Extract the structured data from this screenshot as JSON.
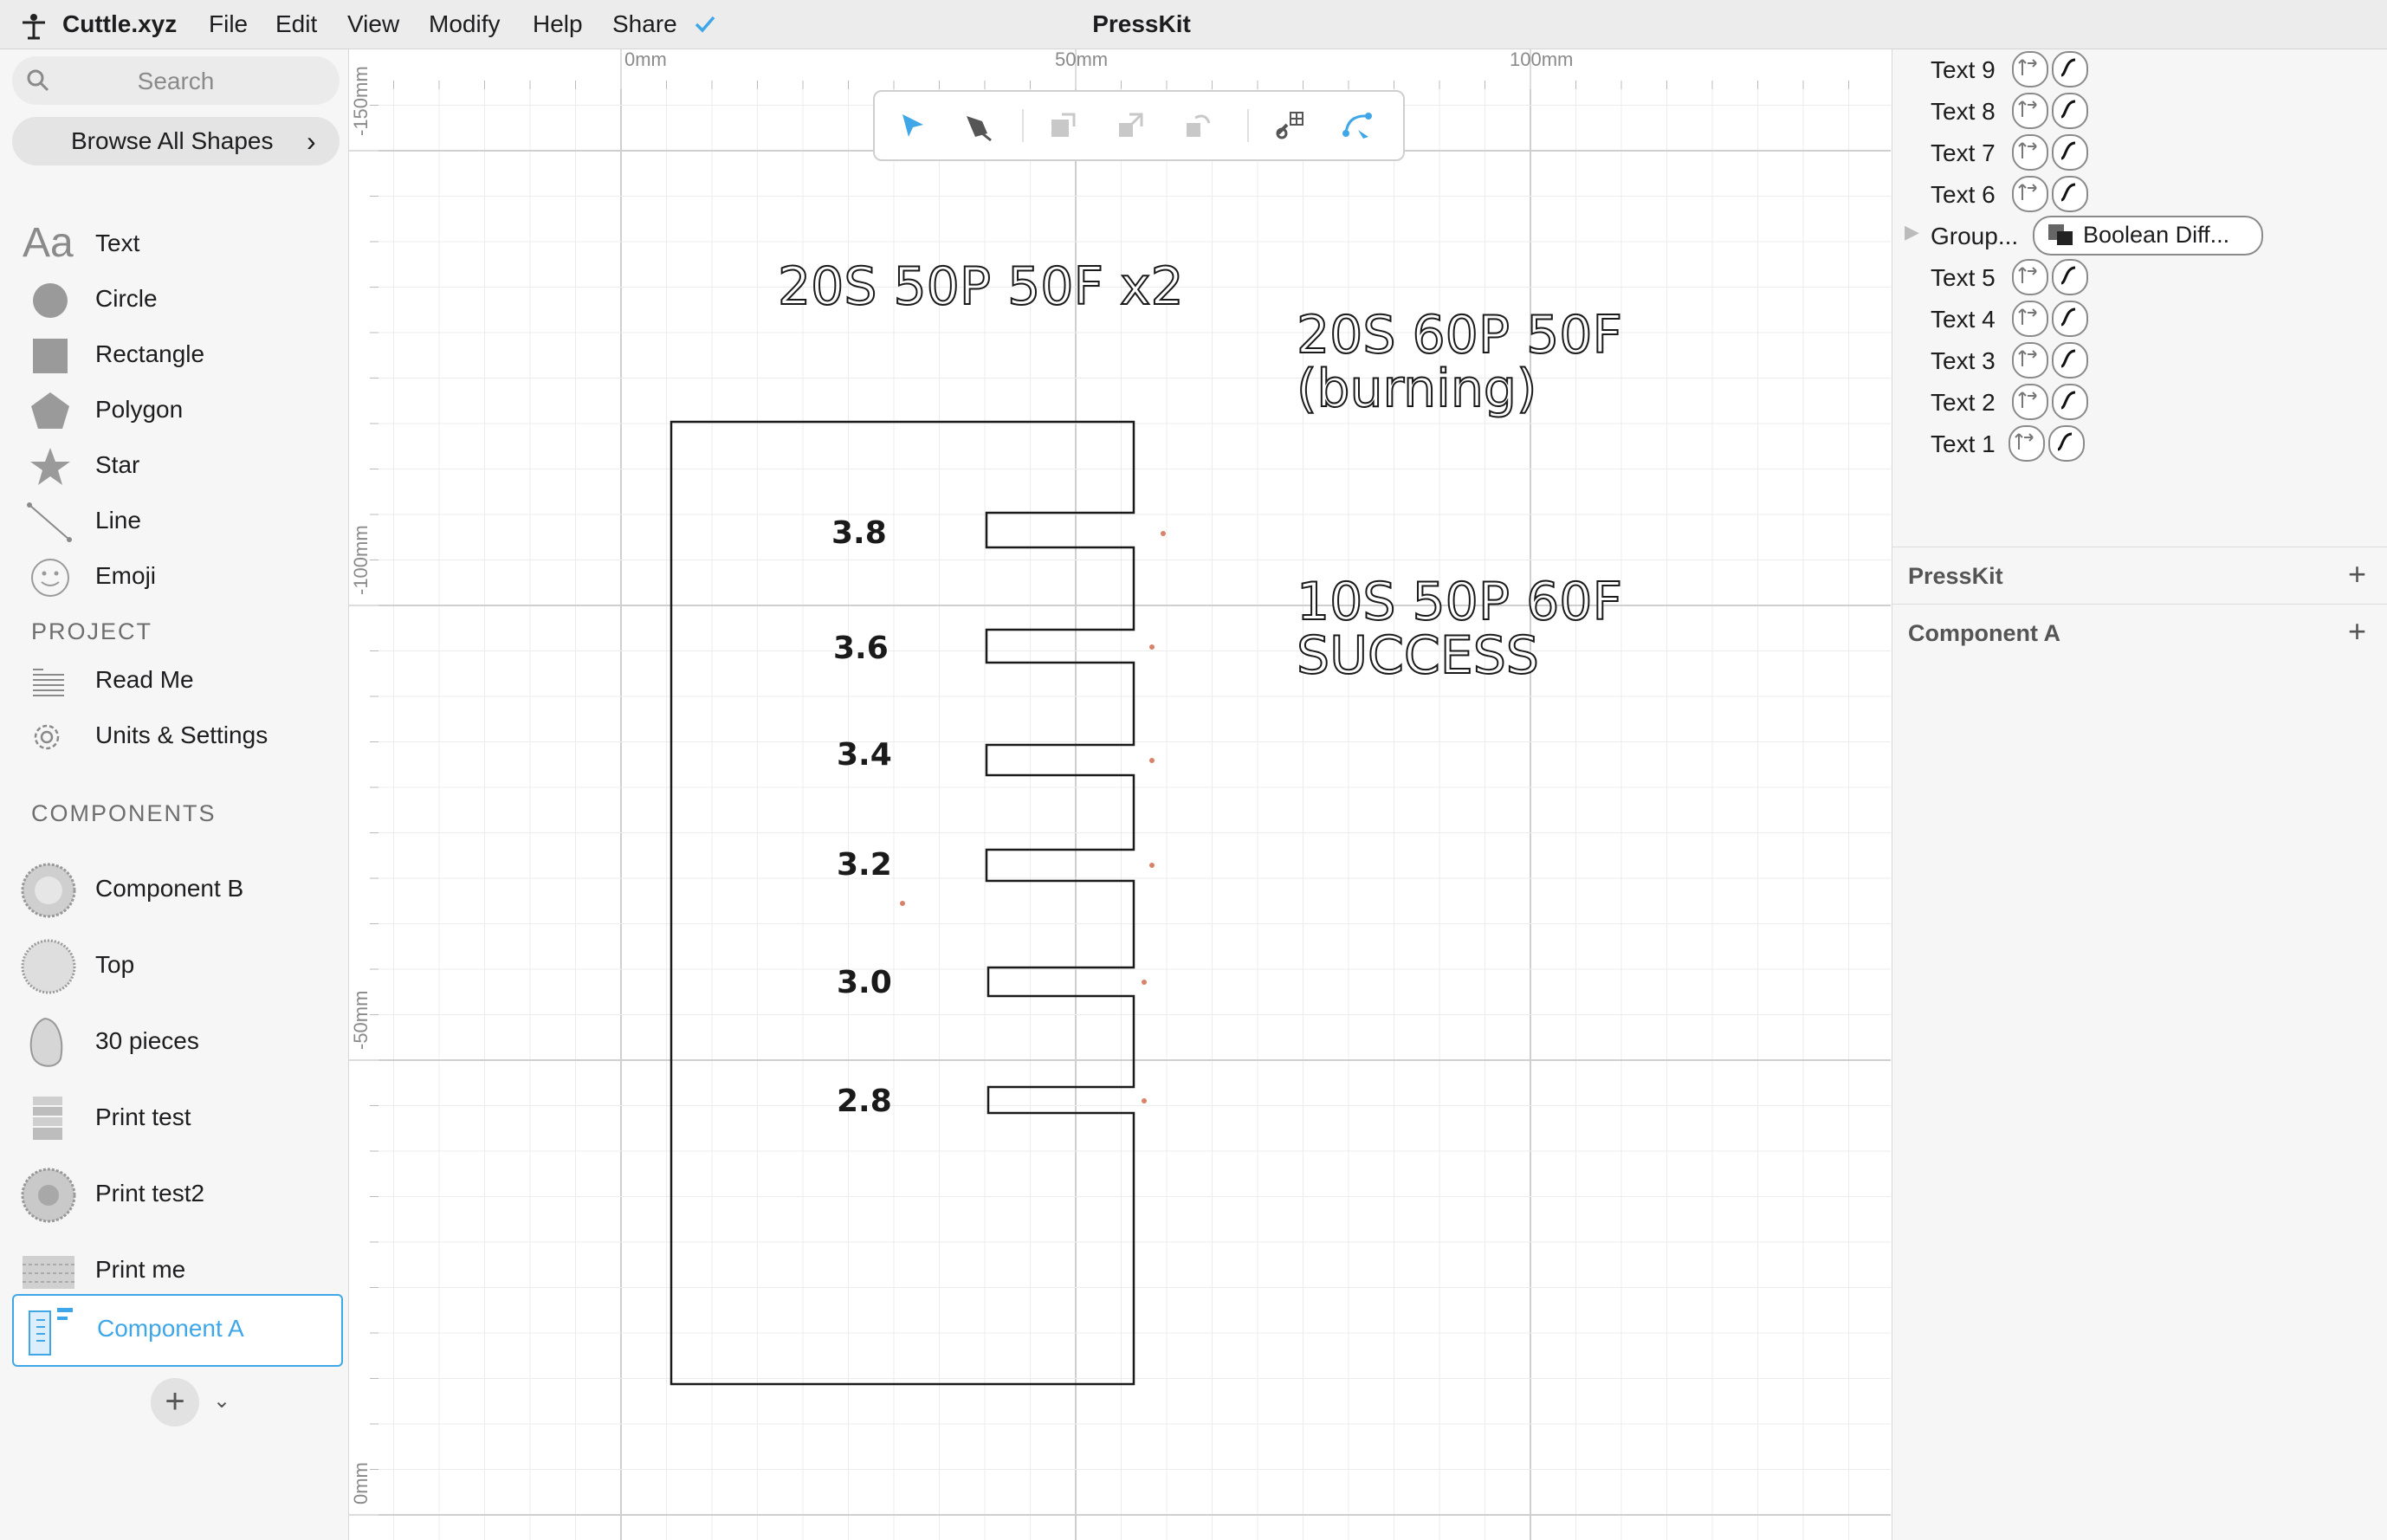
{
  "menubar": {
    "app_name": "Cuttle.xyz",
    "items": [
      "File",
      "Edit",
      "View",
      "Modify",
      "Help",
      "Share"
    ],
    "document_title": "PressKit"
  },
  "sidebar": {
    "search_placeholder": "Search",
    "browse_label": "Browse All Shapes",
    "shapes": [
      "Text",
      "Circle",
      "Rectangle",
      "Polygon",
      "Star",
      "Line",
      "Emoji"
    ],
    "shape_icons": [
      "text-icon",
      "circle-icon",
      "rectangle-icon",
      "polygon-icon",
      "star-icon",
      "line-icon",
      "emoji-icon"
    ],
    "project_heading": "PROJECT",
    "project_items": [
      "Read Me",
      "Units & Settings"
    ],
    "components_heading": "COMPONENTS",
    "components": [
      "Component B",
      "Top",
      "30 pieces",
      "Print test",
      "Print test2",
      "Print me",
      "Component A"
    ],
    "selected_component": "Component A"
  },
  "canvas": {
    "ruler_top": [
      "0mm",
      "50mm",
      "100mm"
    ],
    "ruler_left": [
      "-150mm",
      "-100mm",
      "-50mm",
      "0mm"
    ],
    "labels": {
      "title1": "20S 50P 50F x2",
      "title2_line1": "20S 60P 50F",
      "title2_line2": "(burning)",
      "title3_line1": "10S 50P 60F",
      "title3_line2": "SUCCESS"
    },
    "slot_values": [
      "3.8",
      "3.6",
      "3.4",
      "3.2",
      "3.0",
      "2.8"
    ]
  },
  "toolbar": {
    "tools": [
      "select-arrow-icon",
      "pen-icon",
      "bring-front-icon",
      "scale-icon",
      "send-back-icon",
      "link-grid-icon",
      "path-edit-icon"
    ]
  },
  "right_panel": {
    "layers_top": [
      "Text 9",
      "Text 8",
      "Text 7",
      "Text 6"
    ],
    "group_label": "Group...",
    "group_modifier": "Boolean Diff...",
    "layers_bottom": [
      "Text 5",
      "Text 4",
      "Text 3",
      "Text 2",
      "Text 1"
    ],
    "sections": [
      "PressKit",
      "Component A"
    ]
  },
  "colors": {
    "accent": "#3fa7e8",
    "grid_minor": "#e8e8e8",
    "grid_major": "#d0d0d0",
    "marker": "#d9826a"
  }
}
